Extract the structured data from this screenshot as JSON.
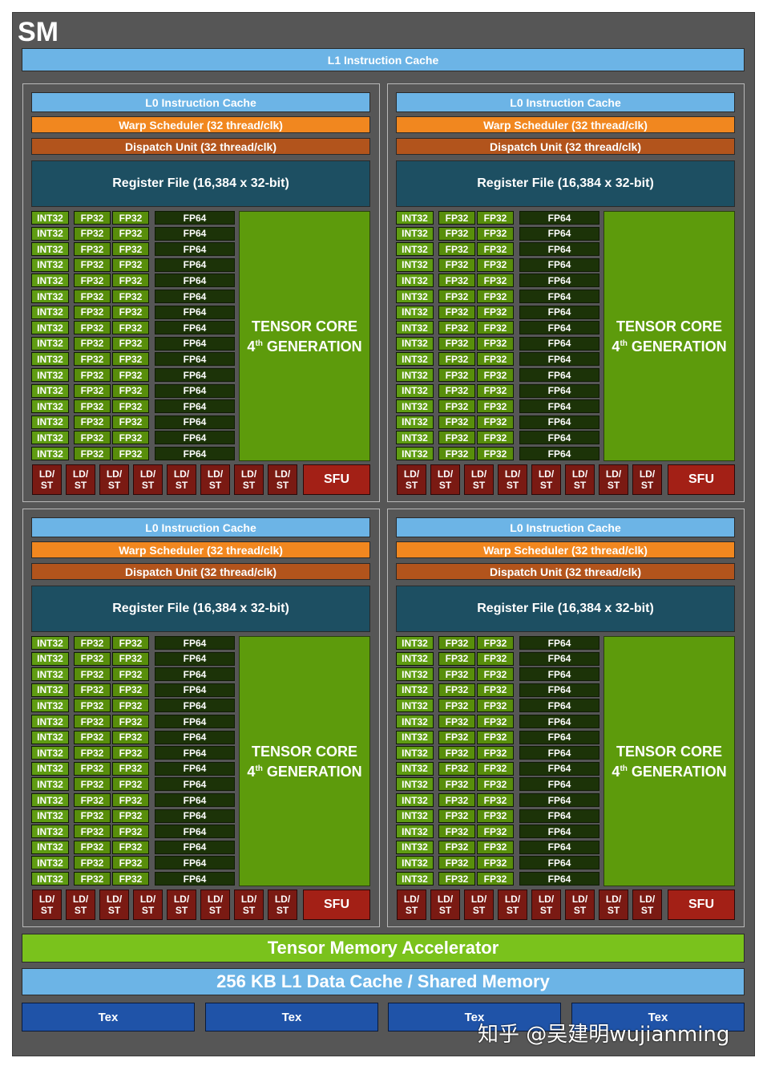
{
  "sm": {
    "title": "SM",
    "l1_instruction_cache": "L1 Instruction Cache",
    "tensor_memory_accelerator": "Tensor Memory Accelerator",
    "l1_data_cache": "256 KB L1 Data Cache / Shared Memory",
    "tex_units": [
      "Tex",
      "Tex",
      "Tex",
      "Tex"
    ]
  },
  "partition": {
    "l0_instruction_cache": "L0 Instruction Cache",
    "warp_scheduler": "Warp Scheduler (32 thread/clk)",
    "dispatch_unit": "Dispatch Unit (32 thread/clk)",
    "register_file": "Register File (16,384 x 32-bit)",
    "int32_label": "INT32",
    "fp32_label": "FP32",
    "fp64_label": "FP64",
    "unit_rows": 16,
    "tensor_core_line1": "TENSOR CORE",
    "tensor_core_ord": "4",
    "tensor_core_sup": "th",
    "tensor_core_line2": "GENERATION",
    "ldst_top": "LD/",
    "ldst_bottom": "ST",
    "ldst_count": 8,
    "sfu": "SFU"
  },
  "partitions": [
    {
      "id": "p0"
    },
    {
      "id": "p1"
    },
    {
      "id": "p2"
    },
    {
      "id": "p3"
    }
  ],
  "watermark": "知乎 @吴建明wujianming"
}
